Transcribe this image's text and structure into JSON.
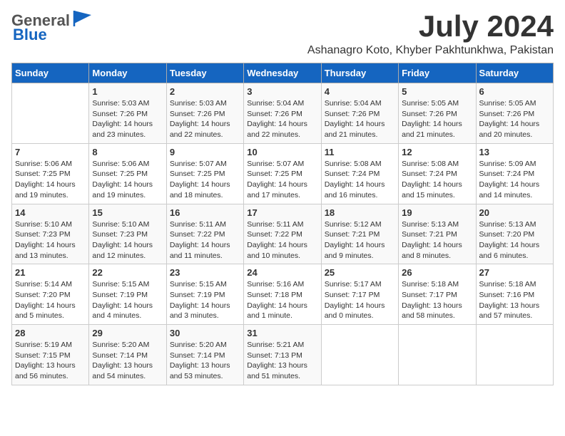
{
  "header": {
    "logo_general": "General",
    "logo_blue": "Blue",
    "title": "July 2024",
    "subtitle": "Ashanagro Koto, Khyber Pakhtunkhwa, Pakistan"
  },
  "weekdays": [
    "Sunday",
    "Monday",
    "Tuesday",
    "Wednesday",
    "Thursday",
    "Friday",
    "Saturday"
  ],
  "weeks": [
    [
      {
        "day": "",
        "info": ""
      },
      {
        "day": "1",
        "info": "Sunrise: 5:03 AM\nSunset: 7:26 PM\nDaylight: 14 hours\nand 23 minutes."
      },
      {
        "day": "2",
        "info": "Sunrise: 5:03 AM\nSunset: 7:26 PM\nDaylight: 14 hours\nand 22 minutes."
      },
      {
        "day": "3",
        "info": "Sunrise: 5:04 AM\nSunset: 7:26 PM\nDaylight: 14 hours\nand 22 minutes."
      },
      {
        "day": "4",
        "info": "Sunrise: 5:04 AM\nSunset: 7:26 PM\nDaylight: 14 hours\nand 21 minutes."
      },
      {
        "day": "5",
        "info": "Sunrise: 5:05 AM\nSunset: 7:26 PM\nDaylight: 14 hours\nand 21 minutes."
      },
      {
        "day": "6",
        "info": "Sunrise: 5:05 AM\nSunset: 7:26 PM\nDaylight: 14 hours\nand 20 minutes."
      }
    ],
    [
      {
        "day": "7",
        "info": "Sunrise: 5:06 AM\nSunset: 7:25 PM\nDaylight: 14 hours\nand 19 minutes."
      },
      {
        "day": "8",
        "info": "Sunrise: 5:06 AM\nSunset: 7:25 PM\nDaylight: 14 hours\nand 19 minutes."
      },
      {
        "day": "9",
        "info": "Sunrise: 5:07 AM\nSunset: 7:25 PM\nDaylight: 14 hours\nand 18 minutes."
      },
      {
        "day": "10",
        "info": "Sunrise: 5:07 AM\nSunset: 7:25 PM\nDaylight: 14 hours\nand 17 minutes."
      },
      {
        "day": "11",
        "info": "Sunrise: 5:08 AM\nSunset: 7:24 PM\nDaylight: 14 hours\nand 16 minutes."
      },
      {
        "day": "12",
        "info": "Sunrise: 5:08 AM\nSunset: 7:24 PM\nDaylight: 14 hours\nand 15 minutes."
      },
      {
        "day": "13",
        "info": "Sunrise: 5:09 AM\nSunset: 7:24 PM\nDaylight: 14 hours\nand 14 minutes."
      }
    ],
    [
      {
        "day": "14",
        "info": "Sunrise: 5:10 AM\nSunset: 7:23 PM\nDaylight: 14 hours\nand 13 minutes."
      },
      {
        "day": "15",
        "info": "Sunrise: 5:10 AM\nSunset: 7:23 PM\nDaylight: 14 hours\nand 12 minutes."
      },
      {
        "day": "16",
        "info": "Sunrise: 5:11 AM\nSunset: 7:22 PM\nDaylight: 14 hours\nand 11 minutes."
      },
      {
        "day": "17",
        "info": "Sunrise: 5:11 AM\nSunset: 7:22 PM\nDaylight: 14 hours\nand 10 minutes."
      },
      {
        "day": "18",
        "info": "Sunrise: 5:12 AM\nSunset: 7:21 PM\nDaylight: 14 hours\nand 9 minutes."
      },
      {
        "day": "19",
        "info": "Sunrise: 5:13 AM\nSunset: 7:21 PM\nDaylight: 14 hours\nand 8 minutes."
      },
      {
        "day": "20",
        "info": "Sunrise: 5:13 AM\nSunset: 7:20 PM\nDaylight: 14 hours\nand 6 minutes."
      }
    ],
    [
      {
        "day": "21",
        "info": "Sunrise: 5:14 AM\nSunset: 7:20 PM\nDaylight: 14 hours\nand 5 minutes."
      },
      {
        "day": "22",
        "info": "Sunrise: 5:15 AM\nSunset: 7:19 PM\nDaylight: 14 hours\nand 4 minutes."
      },
      {
        "day": "23",
        "info": "Sunrise: 5:15 AM\nSunset: 7:19 PM\nDaylight: 14 hours\nand 3 minutes."
      },
      {
        "day": "24",
        "info": "Sunrise: 5:16 AM\nSunset: 7:18 PM\nDaylight: 14 hours\nand 1 minute."
      },
      {
        "day": "25",
        "info": "Sunrise: 5:17 AM\nSunset: 7:17 PM\nDaylight: 14 hours\nand 0 minutes."
      },
      {
        "day": "26",
        "info": "Sunrise: 5:18 AM\nSunset: 7:17 PM\nDaylight: 13 hours\nand 58 minutes."
      },
      {
        "day": "27",
        "info": "Sunrise: 5:18 AM\nSunset: 7:16 PM\nDaylight: 13 hours\nand 57 minutes."
      }
    ],
    [
      {
        "day": "28",
        "info": "Sunrise: 5:19 AM\nSunset: 7:15 PM\nDaylight: 13 hours\nand 56 minutes."
      },
      {
        "day": "29",
        "info": "Sunrise: 5:20 AM\nSunset: 7:14 PM\nDaylight: 13 hours\nand 54 minutes."
      },
      {
        "day": "30",
        "info": "Sunrise: 5:20 AM\nSunset: 7:14 PM\nDaylight: 13 hours\nand 53 minutes."
      },
      {
        "day": "31",
        "info": "Sunrise: 5:21 AM\nSunset: 7:13 PM\nDaylight: 13 hours\nand 51 minutes."
      },
      {
        "day": "",
        "info": ""
      },
      {
        "day": "",
        "info": ""
      },
      {
        "day": "",
        "info": ""
      }
    ]
  ]
}
